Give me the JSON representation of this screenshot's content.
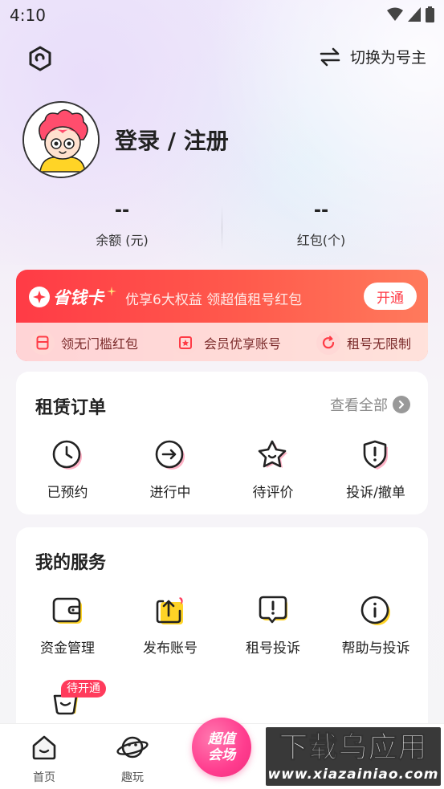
{
  "status_bar": {
    "time": "4:10"
  },
  "header": {
    "switch_label": "切换为号主"
  },
  "profile": {
    "login_label": "登录 / 注册"
  },
  "stats": [
    {
      "value": "--",
      "label": "余额 (元)"
    },
    {
      "value": "--",
      "label": "红包(个)"
    }
  ],
  "vip": {
    "badge": "省钱卡",
    "description": "优享6大权益 领超值租号红包",
    "open_label": "开通",
    "perks": [
      "领无门槛红包",
      "会员优享账号",
      "租号无限制"
    ]
  },
  "orders": {
    "title": "租赁订单",
    "view_all": "查看全部",
    "items": [
      {
        "label": "已预约",
        "icon": "clock-icon"
      },
      {
        "label": "进行中",
        "icon": "arrow-right-circle-icon"
      },
      {
        "label": "待评价",
        "icon": "star-smile-icon"
      },
      {
        "label": "投诉/撤单",
        "icon": "shield-alert-icon"
      }
    ]
  },
  "services": {
    "title": "我的服务",
    "items": [
      {
        "label": "资金管理",
        "icon": "wallet-icon"
      },
      {
        "label": "发布账号",
        "icon": "upload-icon"
      },
      {
        "label": "租号投诉",
        "icon": "alert-message-icon"
      },
      {
        "label": "帮助与投诉",
        "icon": "info-icon"
      }
    ],
    "pending_tag": "待开通"
  },
  "tabbar": {
    "tabs": [
      {
        "label": "首页",
        "icon": "home-icon"
      },
      {
        "label": "趣玩",
        "icon": "planet-icon"
      }
    ],
    "center_line1": "超值",
    "center_line2": "会场"
  },
  "watermark": {
    "main": "下载乌应用",
    "sub": "www.xiazainiao.com"
  },
  "colors": {
    "accent": "#ff3b46",
    "brand_pink": "#ff3c8e",
    "icon_yellow": "#ffd426"
  }
}
